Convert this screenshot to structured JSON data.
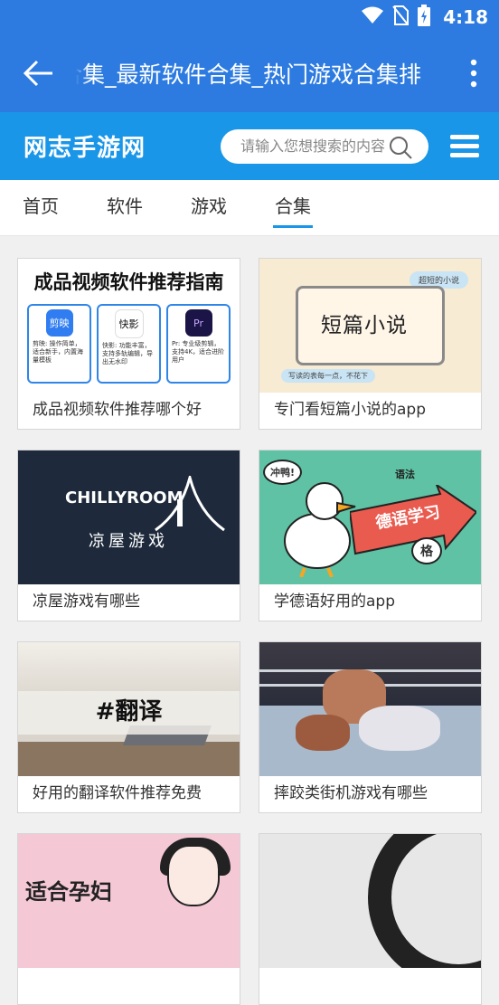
{
  "status": {
    "time": "4:18"
  },
  "appbar": {
    "title": "合集_最新软件合集_热门游戏合集排"
  },
  "site": {
    "logo": "网志手游网",
    "search_placeholder": "请输入您想搜索的内容"
  },
  "tabs": [
    {
      "label": "首页",
      "active": false
    },
    {
      "label": "软件",
      "active": false
    },
    {
      "label": "游戏",
      "active": false
    },
    {
      "label": "合集",
      "active": true
    }
  ],
  "cards": [
    {
      "caption": "成品视频软件推荐哪个好",
      "thumb": {
        "headline": "成品视频软件推荐指南",
        "apps": [
          {
            "name": "剪映",
            "desc": "剪映:\n操作简单，适合新手，内置海量模板"
          },
          {
            "name": "快影",
            "desc": "快影:\n功能丰富，支持多轨编辑，导出无水印"
          },
          {
            "name": "Pr",
            "desc": "Pr:\n专业级剪辑，支持4K，适合进阶用户"
          }
        ]
      }
    },
    {
      "caption": "专门看短篇小说的app",
      "thumb": {
        "title": "短篇小说",
        "bubble": "超短的小说",
        "note": "写读的表每一点，不花下"
      }
    },
    {
      "caption": "凉屋游戏有哪些",
      "thumb": {
        "logo": "CHILLYROOM",
        "cn": "凉屋游戏"
      }
    },
    {
      "caption": "学德语好用的app",
      "thumb": {
        "quack": "冲鸭!",
        "grammar": "语法",
        "main": "德语学习",
        "ge": "格"
      }
    },
    {
      "caption": "好用的翻译软件推荐免费",
      "thumb": {
        "tag": "#翻译"
      }
    },
    {
      "caption": "摔跤类街机游戏有哪些",
      "thumb": {}
    },
    {
      "caption": "",
      "thumb": {
        "text": "适合孕妇"
      }
    },
    {
      "caption": "",
      "thumb": {}
    }
  ]
}
